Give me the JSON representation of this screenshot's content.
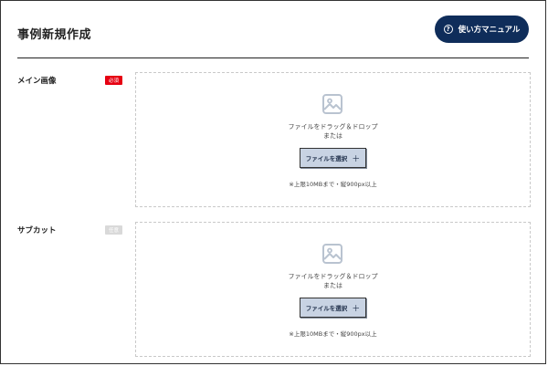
{
  "header": {
    "title": "事例新規作成",
    "manual_button": {
      "label": "使い方マニュアル",
      "icon": "question-circle-icon"
    }
  },
  "fields": [
    {
      "label": "メイン画像",
      "badge": "必須",
      "badge_color": "#e60012",
      "dropzone": {
        "icon": "image-icon",
        "text_line1": "ファイルをドラッグ＆ドロップ",
        "text_line2": "または",
        "button_label": "ファイルを選択",
        "button_icon": "plus-icon",
        "note": "※上限10MBまで・縦900px以上"
      }
    },
    {
      "label": "サブカット",
      "badge": "任意",
      "badge_color": "#d9d9d9",
      "dropzone": {
        "icon": "image-icon",
        "text_line1": "ファイルをドラッグ＆ドロップ",
        "text_line2": "または",
        "button_label": "ファイルを選択",
        "button_icon": "plus-icon",
        "note": "※上限10MBまで・縦900px以上"
      }
    }
  ],
  "colors": {
    "accent": "#0f2d5a",
    "button_bg": "#c8d3e3",
    "dropzone_border": "#c9c9c9"
  }
}
